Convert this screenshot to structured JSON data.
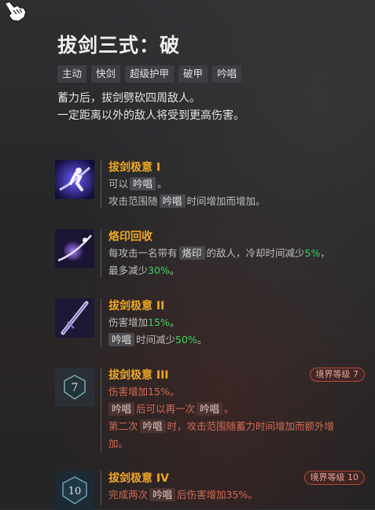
{
  "skill": {
    "title": "拔剑三式：破",
    "tags": [
      "主动",
      "快剑",
      "超级护甲",
      "破甲",
      "吟唱"
    ],
    "description": [
      "蓄力后，拔剑劈砍四周敌人。",
      "一定距离以外的敌人将受到更高伤害。"
    ]
  },
  "colors": {
    "accent_gold": "#f0a81c",
    "bonus_green": "#3ad65a",
    "locked_red": "#d26a52"
  },
  "talents": [
    {
      "name": "拔剑极意 I",
      "icon": "dash-slash-icon",
      "line1": {
        "pre": "可以",
        "hl": "吟唱",
        "post": "。"
      },
      "line2": {
        "pre": "攻击范围随",
        "hl": "吟唱",
        "post": "时间增加而增加。"
      }
    },
    {
      "name": "烙印回收",
      "icon": "purple-orb-icon",
      "line1": {
        "pre": "每攻击一名带有",
        "hl": "烙印",
        "mid": "的敌人，冷却时间减少",
        "val": "5%",
        "post": "，"
      },
      "line2": {
        "pre": "最多减少",
        "val": "30%",
        "post": "。"
      }
    },
    {
      "name": "拔剑极意 II",
      "icon": "sword-icon",
      "line1": {
        "pre": "伤害增加",
        "val": "15%",
        "post": "。"
      },
      "line2": {
        "hl": "吟唱",
        "pre": "时间减少",
        "val": "50%",
        "post": "。"
      }
    },
    {
      "name": "拔剑极意 III",
      "icon": "realm-7-icon",
      "icon_number": "7",
      "badge": "境界等级 7",
      "line1": "伤害增加15%。",
      "line2": {
        "hl": "吟唱",
        "pre": "后可以再一次",
        "hl2": "吟唱",
        "post": "。"
      },
      "line3": {
        "pre": "第二次",
        "hl": "吟唱",
        "post": "时，攻击范围随蓄力时间增加而额外增"
      },
      "line4": "加。"
    },
    {
      "name": "拔剑极意 IV",
      "icon": "realm-10-icon",
      "icon_number": "10",
      "badge": "境界等级 10",
      "line1": {
        "pre": "完成两次",
        "hl": "吟唱",
        "post": "后伤害增加35%。"
      }
    }
  ]
}
